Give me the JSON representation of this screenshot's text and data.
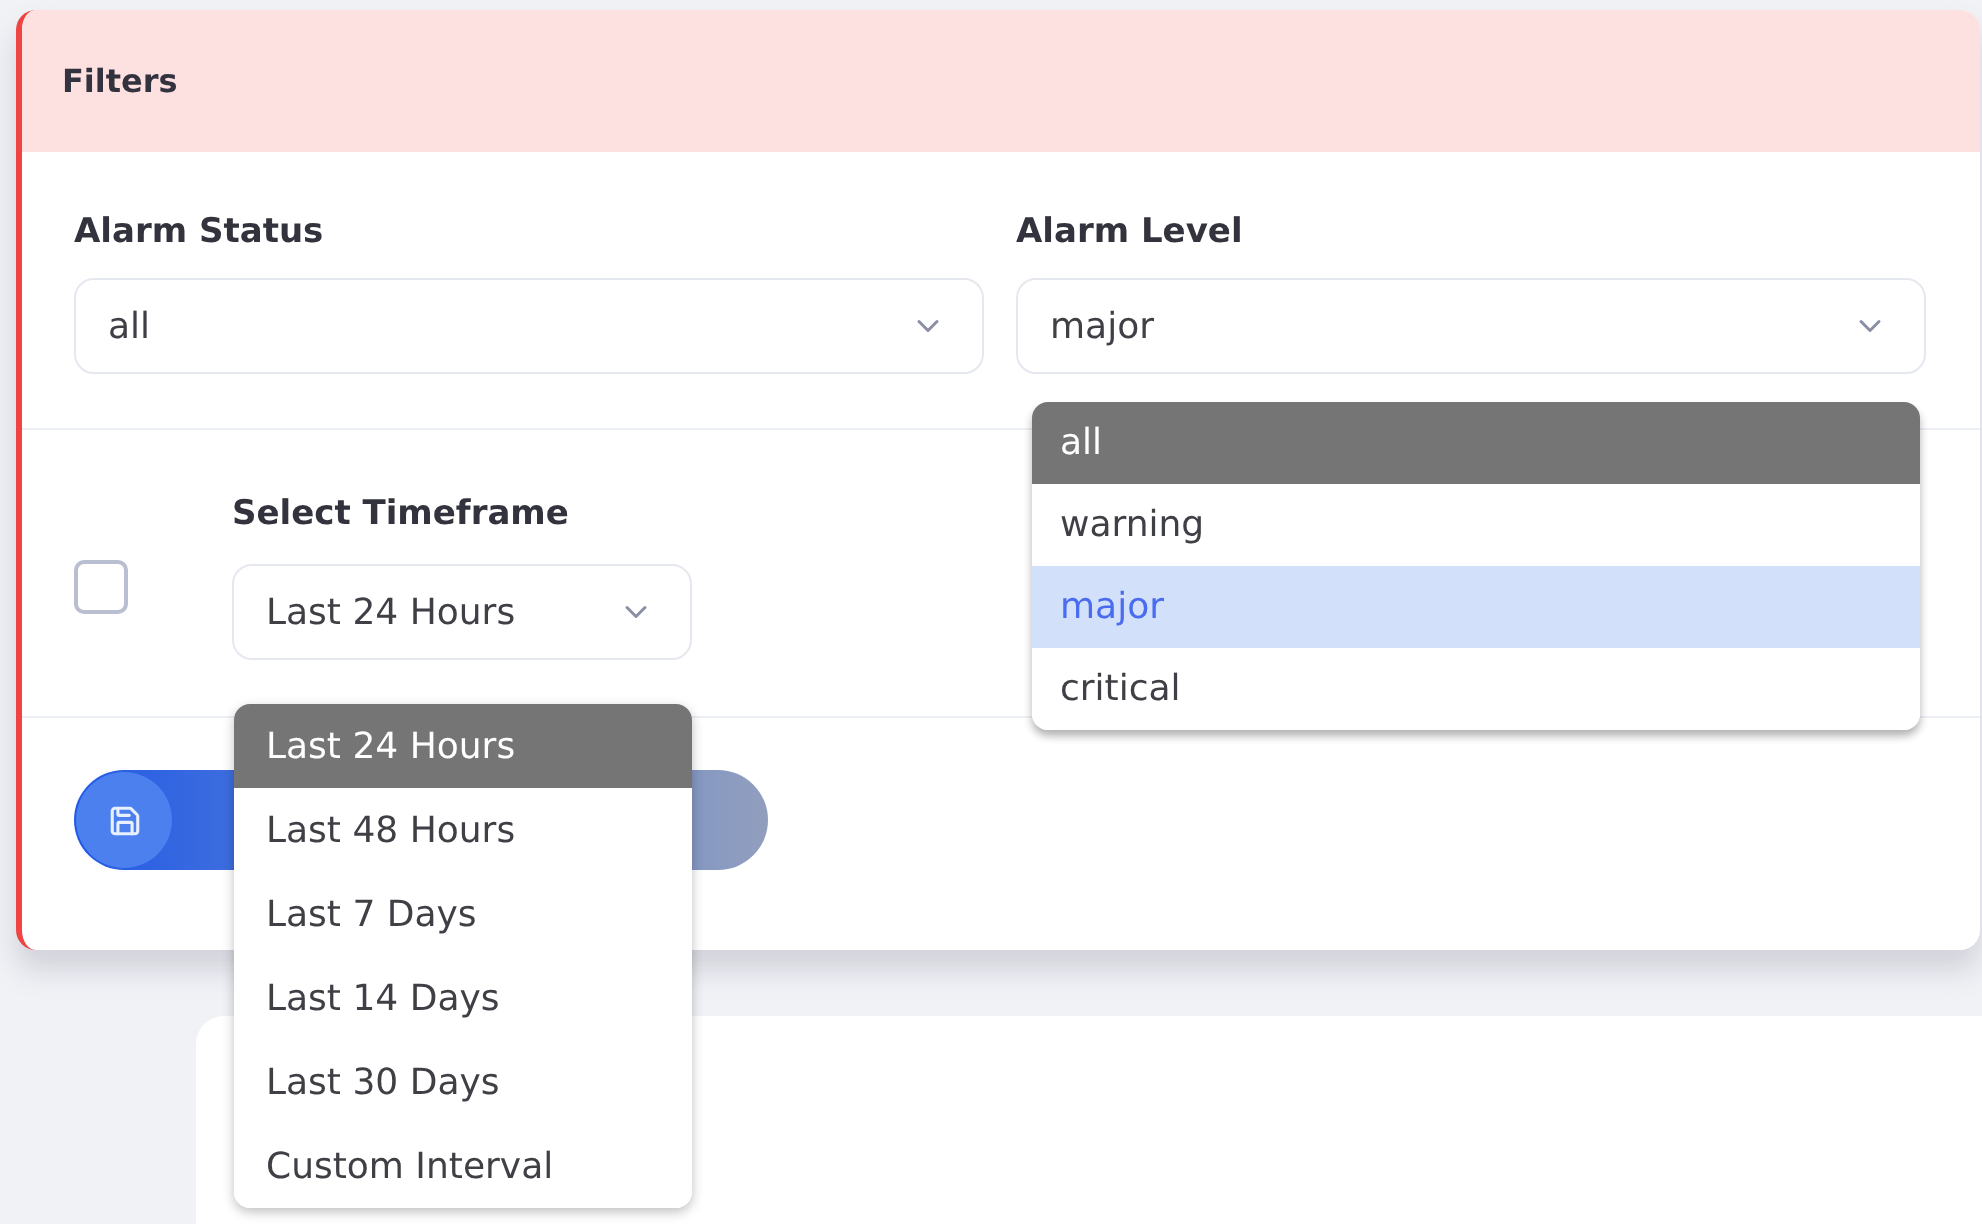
{
  "panel": {
    "title": "Filters"
  },
  "filters": [
    {
      "label": "Alarm Status",
      "value": "all"
    },
    {
      "label": "Alarm Level",
      "value": "major"
    }
  ],
  "timeframe": {
    "checkbox": {
      "checked": false
    },
    "label": "Select Timeframe",
    "value": "Last 24 Hours"
  },
  "alarm_level_menu": {
    "options": [
      {
        "label": "all",
        "highlighted": true,
        "selected": false
      },
      {
        "label": "warning",
        "highlighted": false,
        "selected": false
      },
      {
        "label": "major",
        "highlighted": false,
        "selected": true
      },
      {
        "label": "critical",
        "highlighted": false,
        "selected": false
      }
    ]
  },
  "timeframe_menu": {
    "options": [
      {
        "label": "Last 24 Hours",
        "highlighted": true
      },
      {
        "label": "Last 48 Hours",
        "highlighted": false
      },
      {
        "label": "Last 7 Days",
        "highlighted": false
      },
      {
        "label": "Last 14 Days",
        "highlighted": false
      },
      {
        "label": "Last 30 Days",
        "highlighted": false
      },
      {
        "label": "Custom Interval",
        "highlighted": false
      }
    ]
  }
}
